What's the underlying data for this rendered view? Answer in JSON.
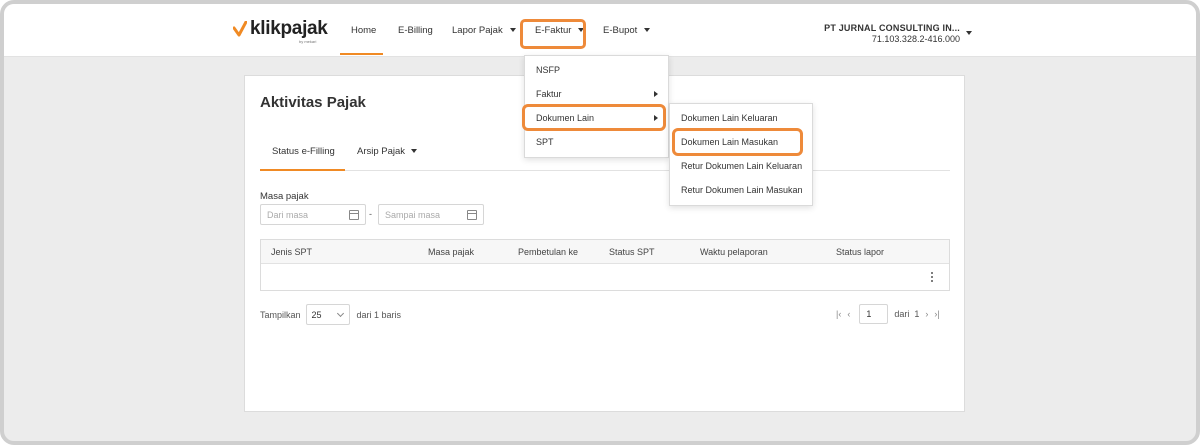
{
  "brand": {
    "name": "klikpajak",
    "sub": "by mekari",
    "accent": "#f08a24",
    "highlight": "#ee8a3a"
  },
  "nav": {
    "home": "Home",
    "ebilling": "E-Billing",
    "lapor": "Lapor Pajak",
    "efaktur": "E-Faktur",
    "ebupot": "E-Bupot"
  },
  "company": {
    "name": "PT JURNAL CONSULTING IN...",
    "npwp": "71.103.328.2-416.000"
  },
  "page": {
    "title": "Aktivitas Pajak"
  },
  "tabs": {
    "status": "Status e-Filling",
    "arsip": "Arsip Pajak"
  },
  "filter": {
    "label": "Masa pajak",
    "from_placeholder": "Dari masa",
    "separator": "-",
    "to_placeholder": "Sampai masa"
  },
  "table": {
    "columns": [
      "Jenis SPT",
      "Masa pajak",
      "Pembetulan ke",
      "Status SPT",
      "Waktu pelaporan",
      "Status lapor"
    ]
  },
  "pagination": {
    "show_label": "Tampilkan",
    "per_page": "25",
    "of_rows": "dari 1 baris",
    "page": "1",
    "of_pages": "dari",
    "total_pages": "1"
  },
  "efaktur_menu": [
    "NSFP",
    "Faktur",
    "Dokumen Lain",
    "SPT"
  ],
  "dokumen_lain_menu": [
    "Dokumen Lain Keluaran",
    "Dokumen Lain Masukan",
    "Retur Dokumen Lain Keluaran",
    "Retur Dokumen Lain Masukan"
  ]
}
